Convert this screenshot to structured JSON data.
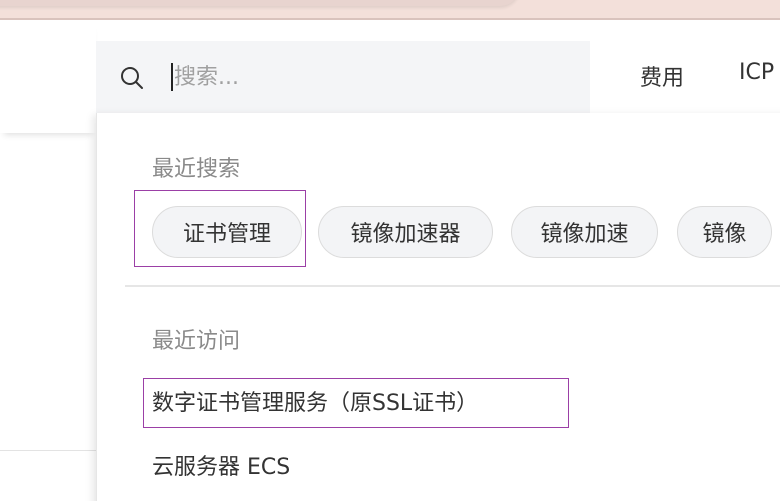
{
  "header": {
    "nav": [
      "费用",
      "ICP"
    ]
  },
  "search": {
    "placeholder": "搜索..."
  },
  "dropdown": {
    "recent_searches_title": "最近搜索",
    "recent_searches": [
      "证书管理",
      "镜像加速器",
      "镜像加速",
      "镜像"
    ],
    "recent_visits_title": "最近访问",
    "recent_visits": [
      "数字证书管理服务（原SSL证书）",
      "云服务器 ECS"
    ]
  },
  "colors": {
    "highlight": "#9b3fa6",
    "search_bg": "#f4f5f7",
    "top_strip": "#f3e0da"
  }
}
